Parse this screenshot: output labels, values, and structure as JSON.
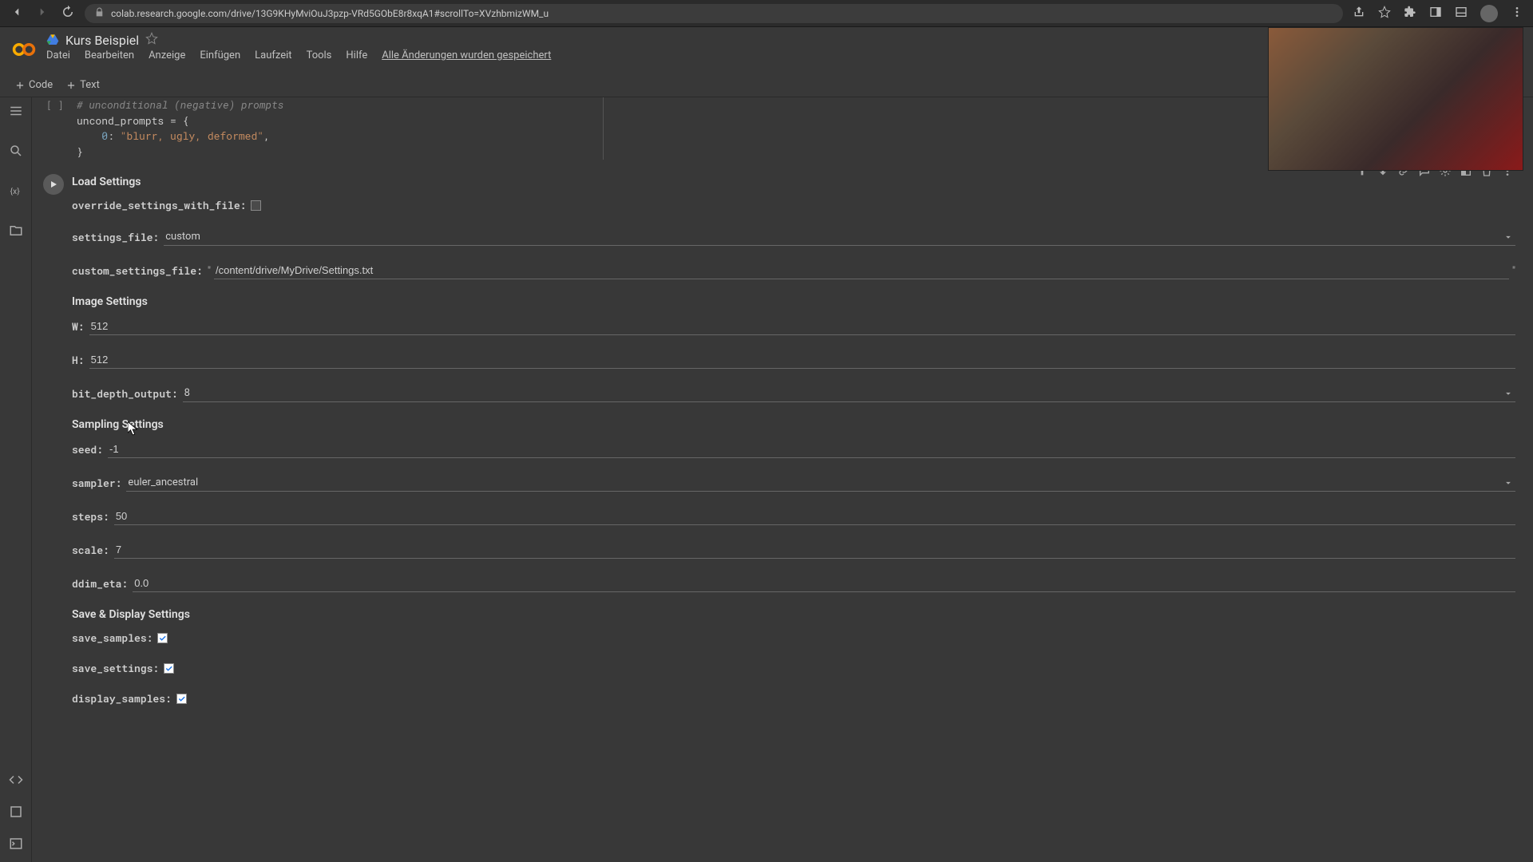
{
  "browser": {
    "url": "colab.research.google.com/drive/13G9KHyMviOuJ3pzp-VRd5GObE8r8xqA1#scrollTo=XVzhbmizWM_u"
  },
  "header": {
    "notebook_title": "Kurs Beispiel"
  },
  "menu": {
    "file": "Datei",
    "edit": "Bearbeiten",
    "view": "Anzeige",
    "insert": "Einfügen",
    "runtime": "Laufzeit",
    "tools": "Tools",
    "help": "Hilfe",
    "saved": "Alle Änderungen wurden gespeichert"
  },
  "toolbar": {
    "code": "Code",
    "text": "Text"
  },
  "code_cell": {
    "comment": "# unconditional (negative) prompts",
    "line1": "uncond_prompts = {",
    "line2_key": "0",
    "line2_val": "\"blurr, ugly, deformed\"",
    "line3": "}"
  },
  "form": {
    "section_load": "Load Settings",
    "override_label": "override_settings_with_file:",
    "override_checked": false,
    "settings_file_label": "settings_file:",
    "settings_file_value": "custom",
    "custom_file_label": "custom_settings_file:",
    "custom_file_value": "/content/drive/MyDrive/Settings.txt",
    "section_image": "Image Settings",
    "w_label": "W:",
    "w_value": "512",
    "h_label": "H:",
    "h_value": "512",
    "bitdepth_label": "bit_depth_output:",
    "bitdepth_value": "8",
    "section_sampling": "Sampling Settings",
    "seed_label": "seed:",
    "seed_value": "-1",
    "sampler_label": "sampler:",
    "sampler_value": "euler_ancestral",
    "steps_label": "steps:",
    "steps_value": "50",
    "scale_label": "scale:",
    "scale_value": "7",
    "ddim_label": "ddim_eta:",
    "ddim_value": "0.0",
    "section_save": "Save & Display Settings",
    "save_samples_label": "save_samples:",
    "save_settings_label": "save_settings:",
    "display_samples_label": "display_samples:"
  }
}
